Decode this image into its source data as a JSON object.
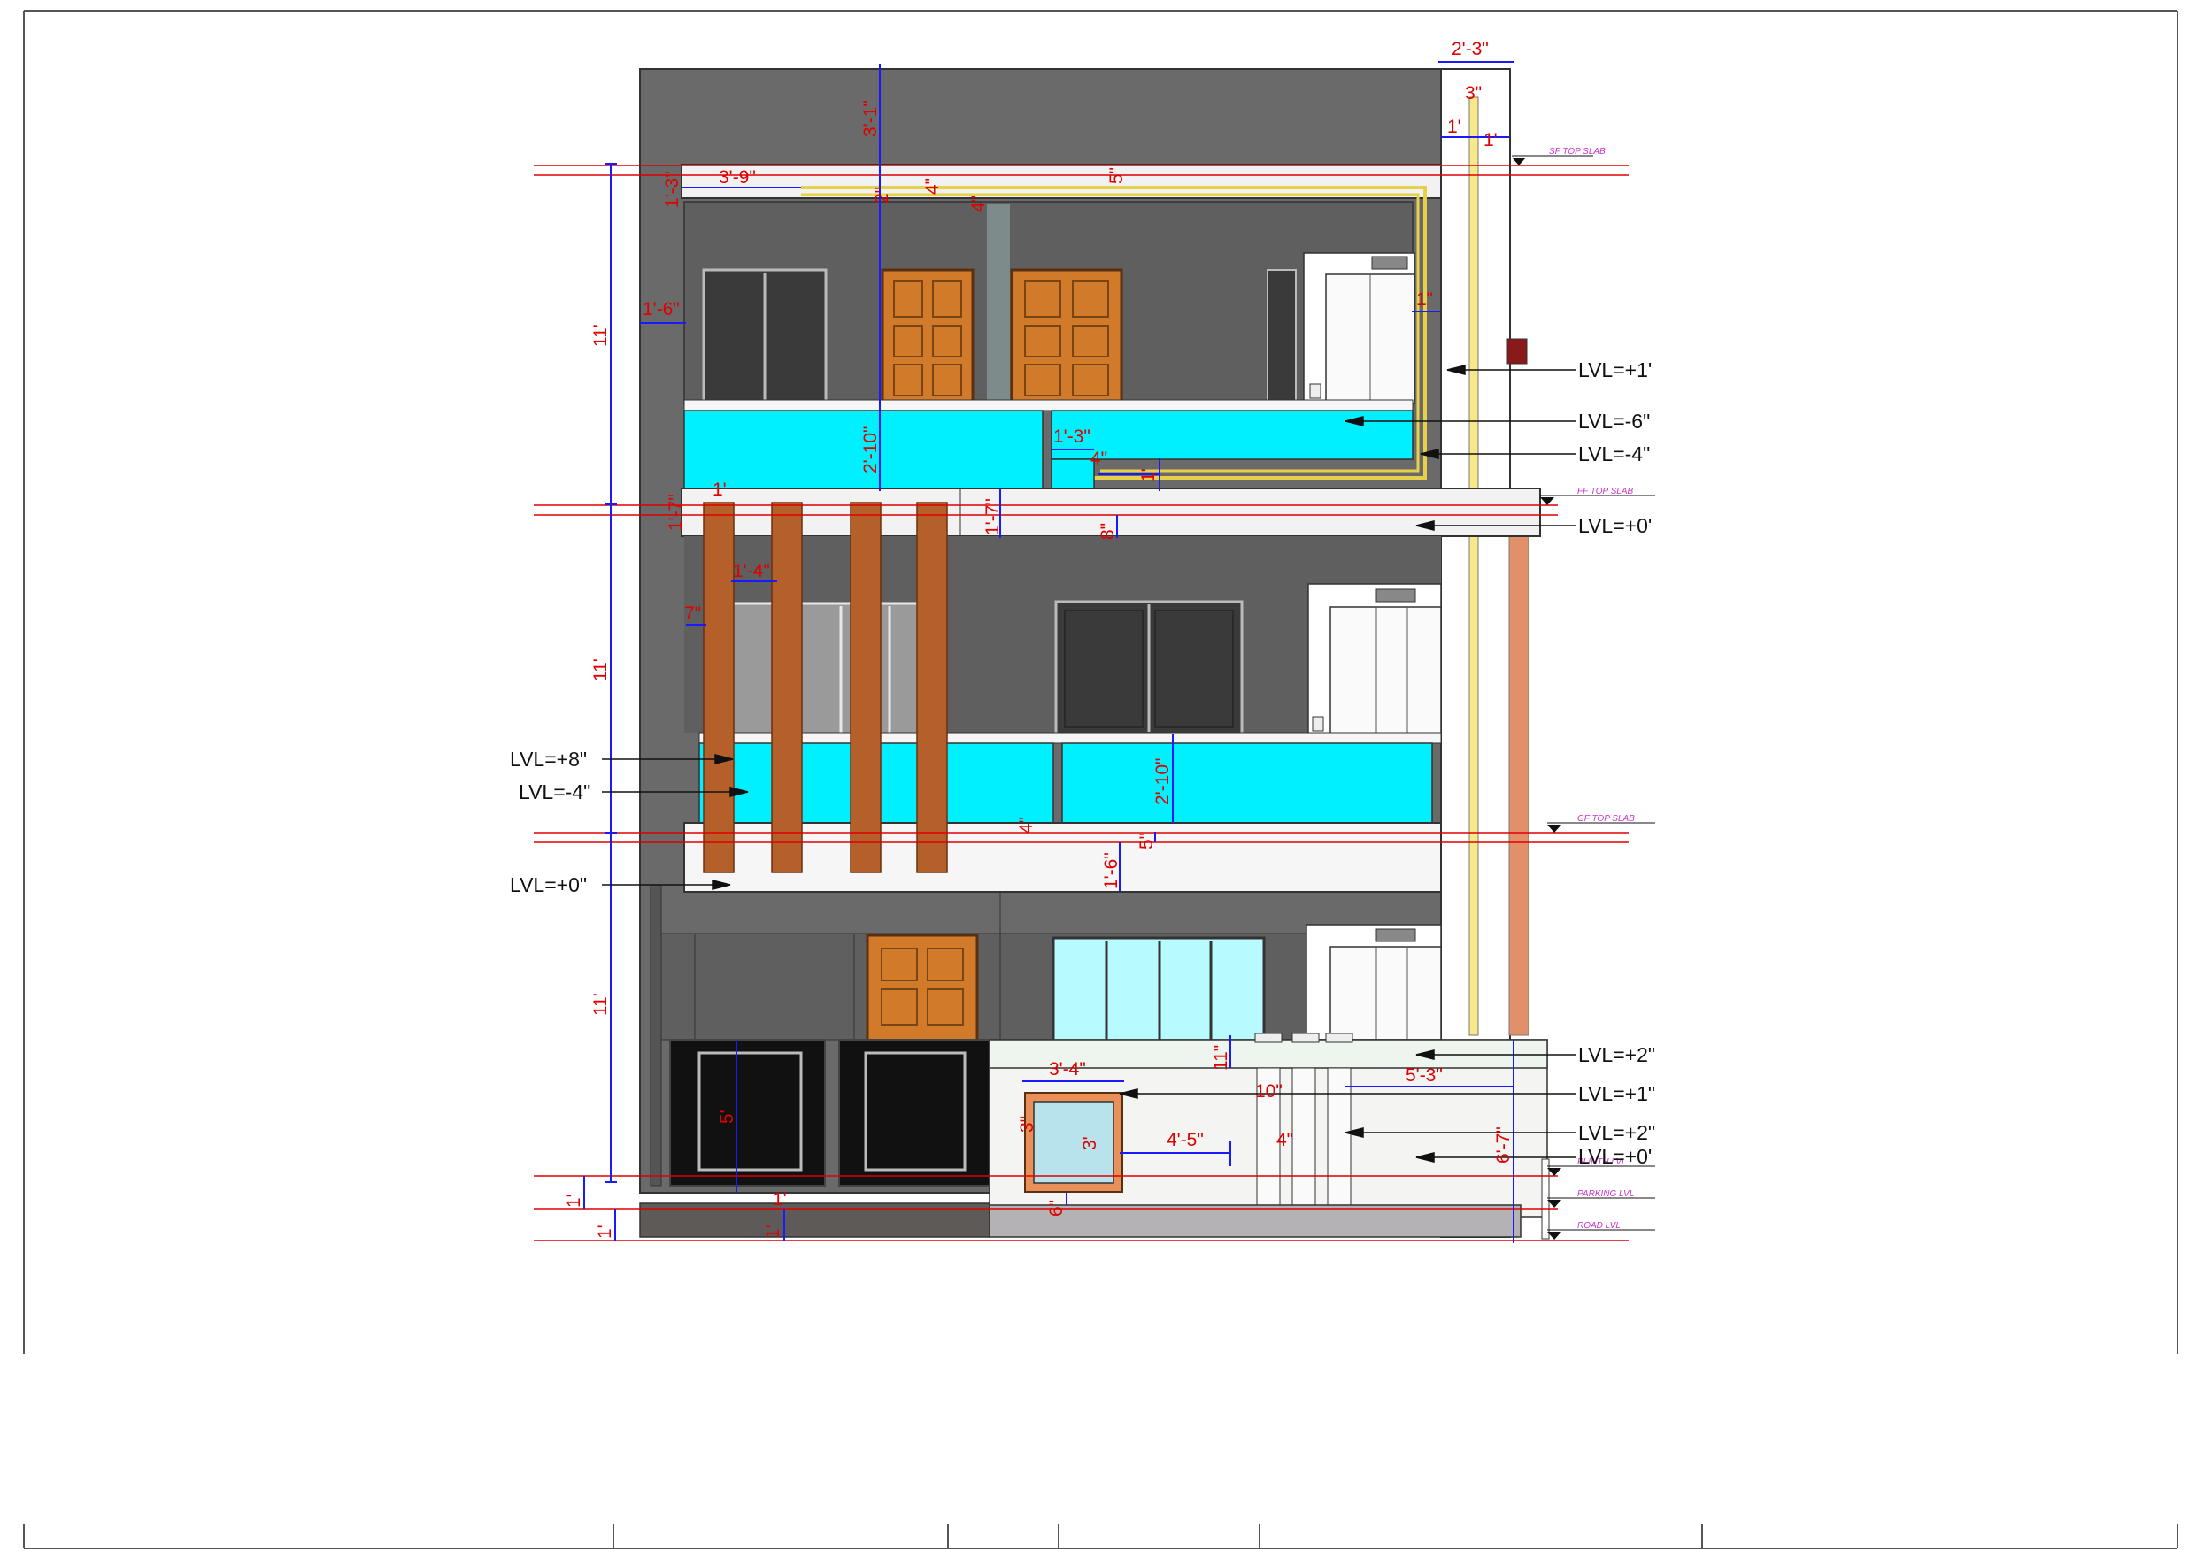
{
  "colors": {
    "wall": "#6a6a6a",
    "slab": "#f2f2f2",
    "glass_rail": "#00f0ff",
    "wood": "#d07a2a",
    "fin": "#b5602a",
    "dim_red": "#e00000",
    "dim_blue": "#1a1aff",
    "tag_magenta": "#cc33cc",
    "ground": "#5e5a57",
    "road": "#b4b2b4",
    "window_dark": "#3a3a3a",
    "window_light": "#b8fbff"
  },
  "slab_tags": {
    "sf_top": "SF TOP SLAB",
    "ff_top": "FF TOP SLAB",
    "gf_top": "GF TOP SLAB",
    "plinth": "PLINTH LVL",
    "parking": "PARKING LVL",
    "road": "ROAD LVL"
  },
  "levels": {
    "sf_plus1": "LVL=+1'",
    "sf_minus6": "LVL=-6\"",
    "sf_minus4": "LVL=-4\"",
    "ff_plus0": "LVL=+0'",
    "ff_plus8": "LVL=+8\"",
    "ff_minus4": "LVL=-4\"",
    "gf_plus0": "LVL=+0\"",
    "gf_plus2": "LVL=+2\"",
    "gf_plus1": "LVL=+1\"",
    "gf_plus2b": "LVL=+2\"",
    "gf_plus0b": "LVL=+0'"
  },
  "dimensions": {
    "top_width": "2'-3\"",
    "top_3": "3\"",
    "top_1a": "1'",
    "top_1b": "1'",
    "parapet": "3'-1\"",
    "slab_1_3": "1'-3\"",
    "canopy": "3'-9\"",
    "d2in": "2\"",
    "d4in": "4\"",
    "d4in_b": "4\"",
    "d5in": "5\"",
    "sf_wall": "1'-6\"",
    "sf_1in": "1\"",
    "sf_rail_h": "2'-10\"",
    "sf_1_3b": "1'-3\"",
    "sf_4in": "4\"",
    "sf_1": "1'",
    "ff_1_7": "1'-7\"",
    "ff_1_7b": "1'-7\"",
    "ff_1": "1'",
    "ff_8in": "8\"",
    "ff_1_4": "1'-4\"",
    "ff_7in": "7\"",
    "ff_rail_h": "2'-10\"",
    "gf_4in": "4\"",
    "gf_5in": "5\"",
    "gf_1_6": "1'-6\"",
    "floor_sf": "11'",
    "floor_ff": "11'",
    "floor_gf": "11'",
    "gate_h": "5'",
    "win_w": "3'-4\"",
    "win_h": "3'",
    "win_3": "3\"",
    "win_6": "6\"",
    "wall_4_5": "4'-5\"",
    "d10": "10\"",
    "d11": "11\"",
    "d4c": "4\"",
    "d5_3": "5'-3\"",
    "d6_7": "6'-7\"",
    "plinth_1": "1'",
    "road_1": "1'",
    "step_1": "1'",
    "step_1b": "1'"
  }
}
